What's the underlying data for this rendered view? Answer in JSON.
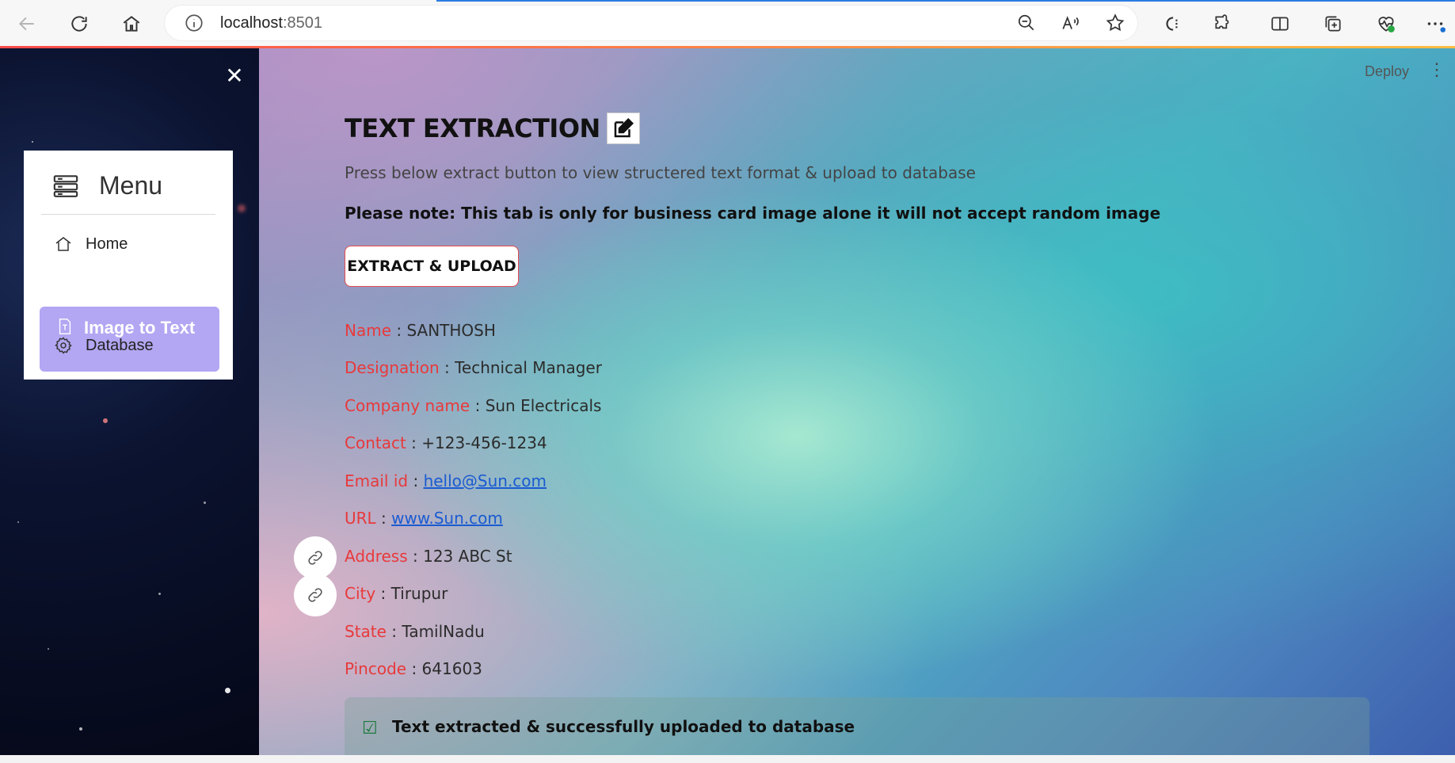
{
  "browser": {
    "url_host": "localhost",
    "url_port": ":8501"
  },
  "sidebar": {
    "menu_title": "Menu",
    "items": [
      {
        "label": "Home",
        "icon": "house-icon"
      },
      {
        "label": "Image to Text",
        "icon": "file-text-icon",
        "active": true
      },
      {
        "label": "Database",
        "icon": "gear-icon"
      }
    ]
  },
  "header": {
    "deploy_label": "Deploy"
  },
  "main": {
    "title": "TEXT EXTRACTION",
    "subtitle": "Press below extract button to view structered text format & upload to database",
    "note": "Please note: This tab is only for business card image alone it will not accept random image",
    "button_label": "EXTRACT & UPLOAD",
    "fields": [
      {
        "key": "Name",
        "value": "SANTHOSH"
      },
      {
        "key": "Designation",
        "value": "Technical Manager"
      },
      {
        "key": "Company name",
        "value": "Sun Electricals"
      },
      {
        "key": "Contact",
        "value": "+123-456-1234"
      },
      {
        "key": "Email id",
        "value": "hello@Sun.com"
      },
      {
        "key": "URL",
        "value": "www.Sun.com"
      },
      {
        "key": "Address",
        "value": "123 ABC St"
      },
      {
        "key": "City",
        "value": "Tirupur"
      },
      {
        "key": "State",
        "value": "TamilNadu"
      },
      {
        "key": "Pincode",
        "value": "641603"
      }
    ],
    "separator": " : ",
    "success_message": "Text extracted & successfully uploaded to database"
  },
  "colors": {
    "accent_key": "#e8393b",
    "menu_active": "#b3a6f2",
    "link": "#1a5bd1"
  }
}
